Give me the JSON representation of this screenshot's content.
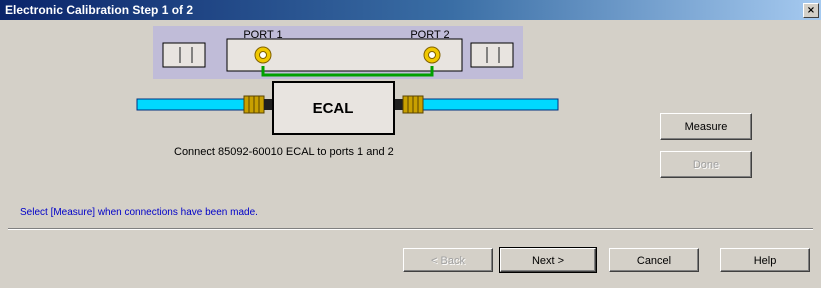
{
  "window": {
    "title": "Electronic Calibration Step 1 of 2",
    "close_glyph": "×"
  },
  "diagram": {
    "port1_label": "PORT 1",
    "port2_label": "PORT 2",
    "ecal_label": "ECAL",
    "caption": "Connect 85092-60010 ECAL to ports 1 and 2"
  },
  "side_buttons": {
    "measure": "Measure",
    "done": "Done"
  },
  "hint": "Select [Measure] when connections have been made.",
  "footer": {
    "back": "< Back",
    "next": "Next >",
    "cancel": "Cancel",
    "help": "Help"
  },
  "colors": {
    "cable": "#00d8ff",
    "connector": "#c8a000",
    "panel": "#c0bcd8",
    "accent_text": "#0000c8"
  }
}
